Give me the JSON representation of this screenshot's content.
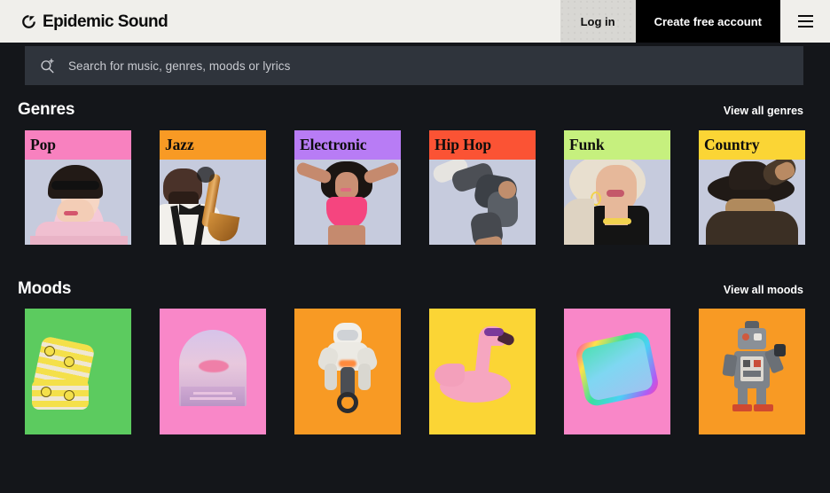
{
  "header": {
    "brand_name": "Epidemic Sound",
    "brand_mark_icon": "epidemic-sound-logo-icon",
    "login_label": "Log in",
    "create_account_label": "Create free account",
    "menu_icon": "hamburger-menu-icon"
  },
  "search": {
    "icon": "search-add-icon",
    "placeholder": "Search for music, genres, moods or lyrics",
    "value": ""
  },
  "genres": {
    "title": "Genres",
    "view_all_label": "View all genres",
    "cards": [
      {
        "label": "Pop",
        "strip_color": "#f881bf",
        "art_bg": "#c6cbdd",
        "art": "pop-portrait"
      },
      {
        "label": "Jazz",
        "strip_color": "#f89a24",
        "art_bg": "#c6cbdd",
        "art": "jazz-saxophonist"
      },
      {
        "label": "Electronic",
        "strip_color": "#b87cf5",
        "art_bg": "#c6cbdd",
        "art": "electronic-dancer"
      },
      {
        "label": "Hip Hop",
        "strip_color": "#fb5334",
        "art_bg": "#c6cbdd",
        "art": "hiphop-breakdancer"
      },
      {
        "label": "Funk",
        "strip_color": "#c6f07e",
        "art_bg": "#c6cbdd",
        "art": "funk-portrait"
      },
      {
        "label": "Country",
        "strip_color": "#fbd535",
        "art_bg": "#c6cbdd",
        "art": "country-cowboy-hat"
      }
    ]
  },
  "moods": {
    "title": "Moods",
    "view_all_label": "View all moods",
    "cards": [
      {
        "bg_color": "#5ccb5f",
        "art": "stacked-smiley-sticker-rolls"
      },
      {
        "bg_color": "#f987c8",
        "art": "pink-arch-sunset"
      },
      {
        "bg_color": "#f89a24",
        "art": "astronaut-on-motorcycle"
      },
      {
        "bg_color": "#fbd535",
        "art": "pink-flamingo-pool-float"
      },
      {
        "bg_color": "#f987c8",
        "art": "iridescent-holographic-square"
      },
      {
        "bg_color": "#f89a24",
        "art": "retro-tin-toy-robot"
      }
    ]
  },
  "colors": {
    "page_bg": "#14161a",
    "header_bg": "#f0efeb",
    "search_bg": "#2f343c",
    "accent_black": "#000000",
    "text_light": "#ffffff"
  }
}
